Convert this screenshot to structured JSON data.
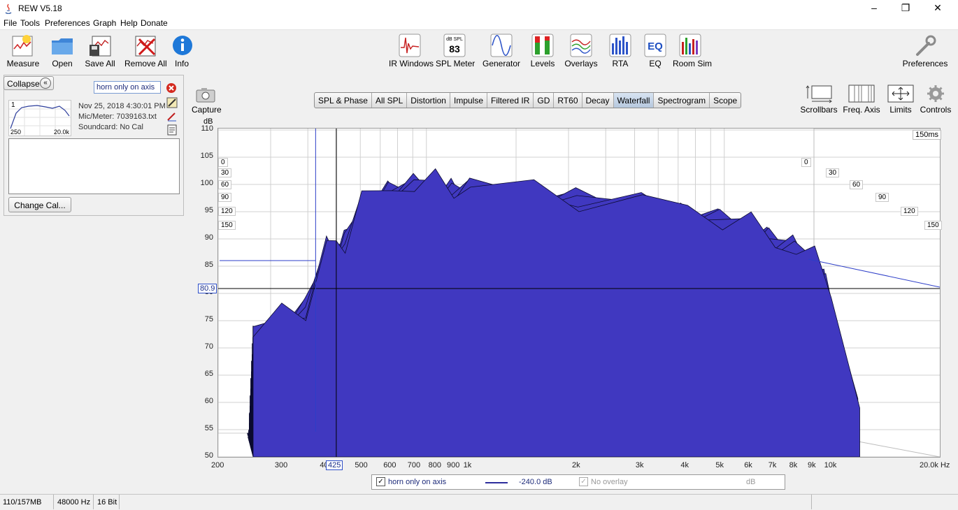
{
  "window": {
    "title": "REW V5.18"
  },
  "menu": [
    "File",
    "Tools",
    "Preferences",
    "Graph",
    "Help",
    "Donate"
  ],
  "toolbar": {
    "measure": "Measure",
    "open": "Open",
    "save_all": "Save All",
    "remove_all": "Remove All",
    "info": "Info",
    "ir_windows": "IR Windows",
    "spl_meter": "SPL Meter",
    "spl_meter_top": "dB SPL",
    "spl_meter_value": "83",
    "generator": "Generator",
    "levels": "Levels",
    "overlays": "Overlays",
    "rta": "RTA",
    "eq": "EQ",
    "eq_icon": "EQ",
    "room_sim": "Room Sim",
    "preferences": "Preferences"
  },
  "side_panel": {
    "collapse": "Collapse",
    "measurement_name": "horn only on axis",
    "measurement_index": "1",
    "thumb_low": "250",
    "thumb_high": "20.0k",
    "date": "Nov 25, 2018 4:30:01 PM",
    "mic": "Mic/Meter: 7039163.txt",
    "soundcard": "Soundcard: No Cal",
    "change_cal": "Change Cal..."
  },
  "capture": "Capture",
  "tabs": [
    "SPL & Phase",
    "All SPL",
    "Distortion",
    "Impulse",
    "Filtered IR",
    "GD",
    "RT60",
    "Decay",
    "Waterfall",
    "Spectrogram",
    "Scope"
  ],
  "active_tab": "Waterfall",
  "graph_controls": {
    "scrollbars": "Scrollbars",
    "freq_axis": "Freq. Axis",
    "limits": "Limits",
    "controls": "Controls"
  },
  "chart_data": {
    "type": "area",
    "title": "",
    "ylabel": "dB",
    "xlabel": "",
    "y_ticks": [
      "110",
      "105",
      "100",
      "95",
      "90",
      "85",
      "80",
      "75",
      "70",
      "65",
      "60",
      "55",
      "50"
    ],
    "x_ticks": [
      "200",
      "300",
      "400",
      "500",
      "600",
      "700",
      "800",
      "900",
      "1k",
      "2k",
      "3k",
      "4k",
      "5k",
      "6k",
      "7k",
      "8k",
      "9k",
      "10k",
      "20.0k Hz"
    ],
    "z_ticks_ms": [
      "0",
      "30",
      "60",
      "90",
      "120",
      "150"
    ],
    "z_axis_max_label": "150ms",
    "ylim": [
      50,
      110
    ],
    "xlim_hz": [
      200,
      20000
    ],
    "x_scale": "log",
    "cursor": {
      "y_db": "80.9",
      "x_hz": "425"
    },
    "series_color": "#4038c0",
    "x": [
      250,
      300,
      350,
      400,
      425,
      450,
      500,
      600,
      700,
      800,
      900,
      1000,
      1500,
      2000,
      3000,
      4000,
      5000,
      6000,
      7000,
      8000,
      9000,
      10000,
      12000
    ],
    "series": [
      {
        "values": [
          72,
          76,
          78,
          88,
          89,
          90,
          96,
          100,
          100,
          100,
          100,
          99,
          99,
          98,
          96,
          96,
          94,
          92,
          90,
          88,
          86,
          82,
          58
        ]
      }
    ]
  },
  "legend": {
    "name": "horn only on axis",
    "value": "-240.0 dB",
    "overlay": "No overlay",
    "overlay_unit": "dB"
  },
  "status": {
    "memory": "110/157MB",
    "rate": "48000 Hz",
    "bits": "16 Bit"
  }
}
